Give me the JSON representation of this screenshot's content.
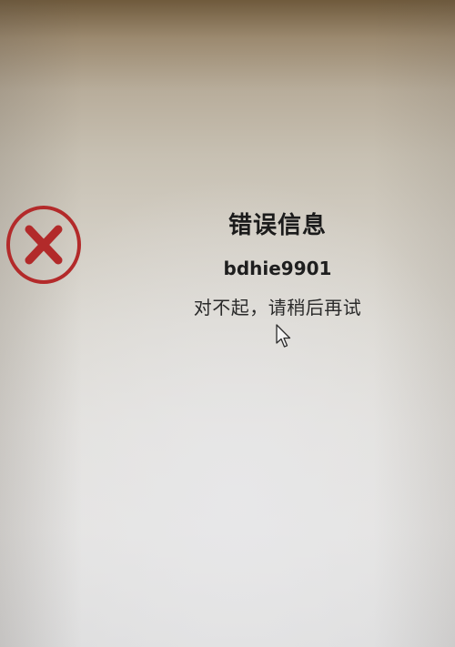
{
  "dialog": {
    "title": "错误信息",
    "error_code": "bdhie9901",
    "message": "对不起，请稍后再试",
    "icon": "error-x-circle-icon",
    "icon_color": "#b32a2a"
  },
  "pointer": {
    "icon": "mouse-pointer-icon"
  }
}
